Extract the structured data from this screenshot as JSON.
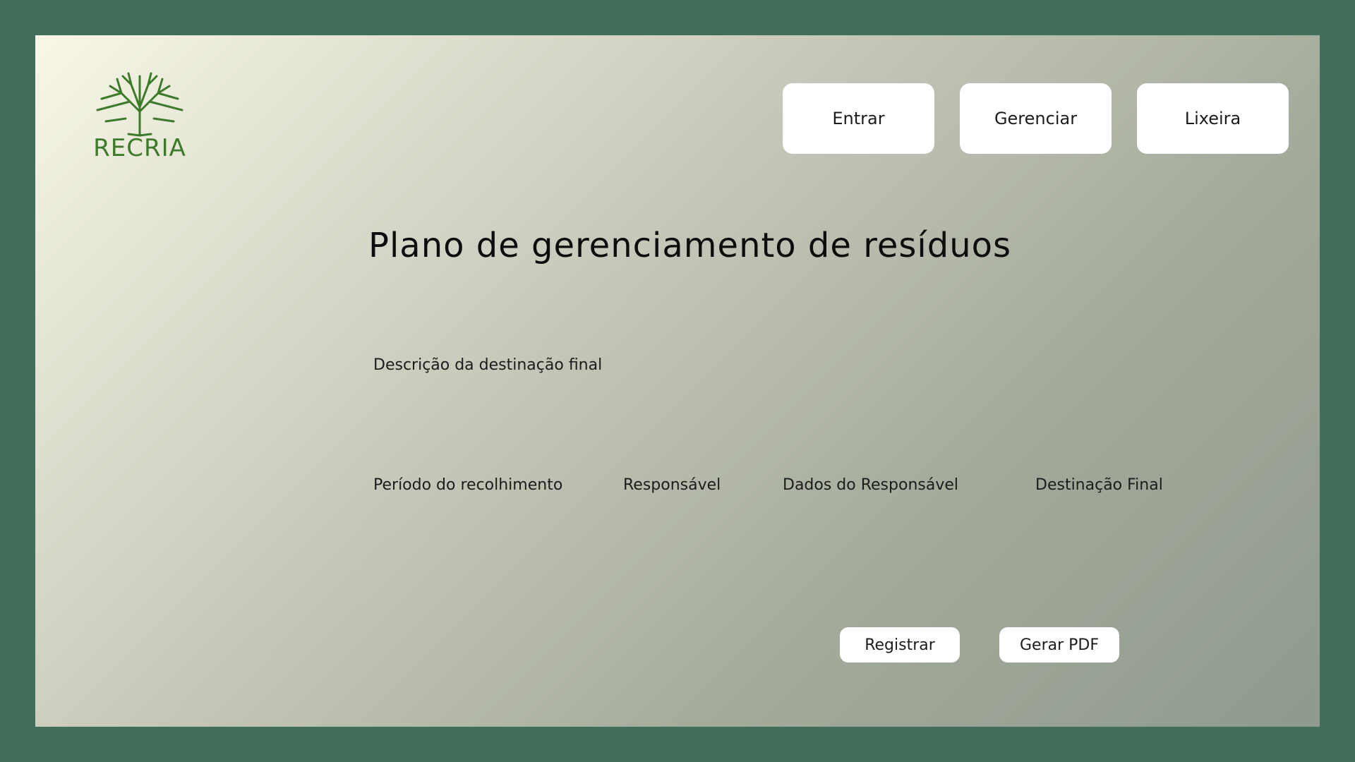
{
  "brand": {
    "logo_text": "RECRIA",
    "logo_color": "#3d7a2a"
  },
  "nav": {
    "entrar": "Entrar",
    "gerenciar": "Gerenciar",
    "lixeira": "Lixeira"
  },
  "main": {
    "title": "Plano de gerenciamento de resíduos",
    "fields": {
      "descricao": "Descrição da destinação final",
      "periodo": "Período do recolhimento",
      "responsavel": "Responsável",
      "dados_responsavel": "Dados do Responsável",
      "destinacao_final": "Destinação Final"
    }
  },
  "actions": {
    "registrar": "Registrar",
    "gerar_pdf": "Gerar PDF"
  },
  "colors": {
    "page_border": "#426e5c",
    "button_bg": "#ffffff"
  }
}
